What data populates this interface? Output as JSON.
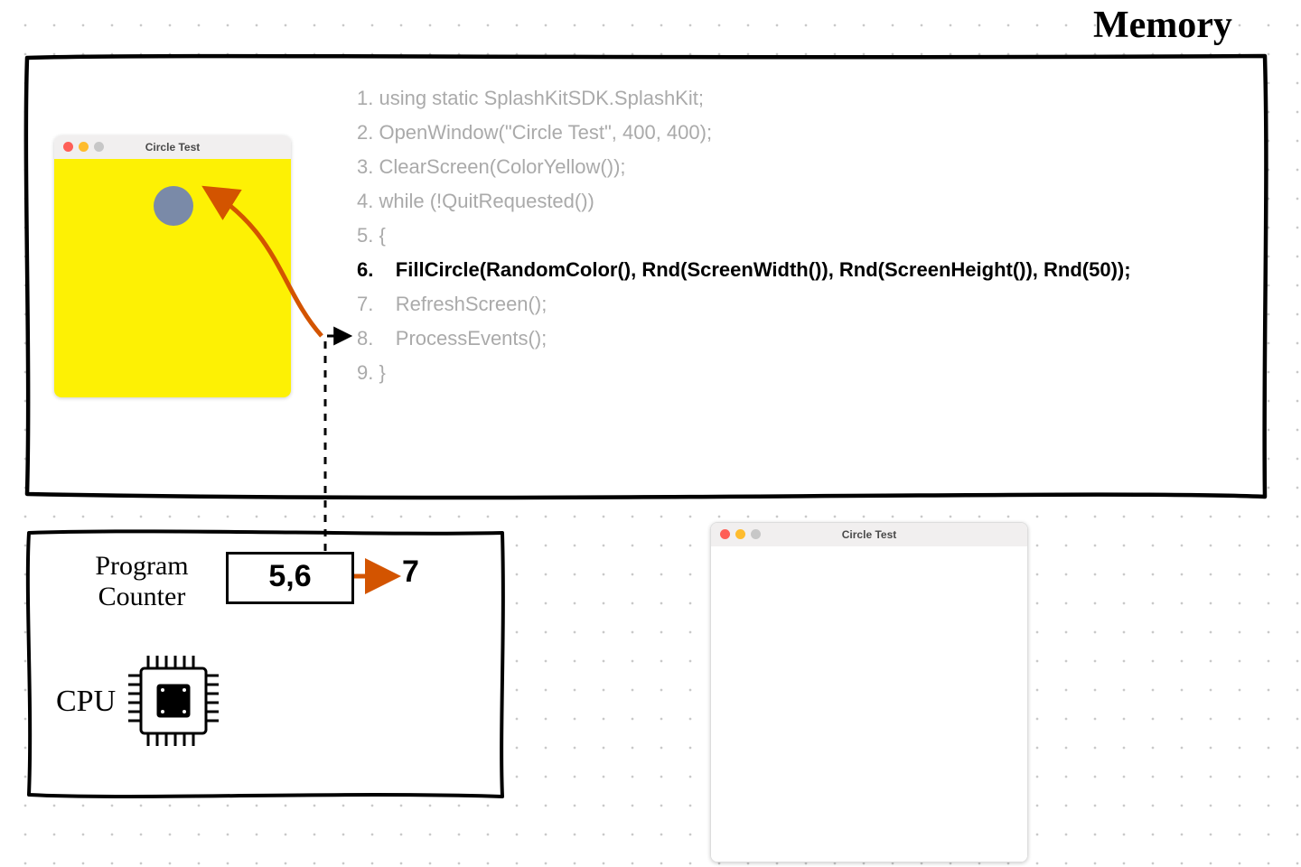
{
  "labels": {
    "memory": "Memory",
    "program_counter_line1": "Program",
    "program_counter_line2": "Counter",
    "cpu": "CPU"
  },
  "code": {
    "active_index": 5,
    "lines": [
      "1. using static SplashKitSDK.SplashKit;",
      "",
      "2. OpenWindow(\"Circle Test\", 400, 400);",
      "3. ClearScreen(ColorYellow());",
      "",
      "4. while (!QuitRequested())",
      "5. {",
      "6.    FillCircle(RandomColor(), Rnd(ScreenWidth()), Rnd(ScreenHeight()), Rnd(50));",
      "7.    RefreshScreen();",
      "8.    ProcessEvents();",
      "9. }"
    ]
  },
  "program_counter": {
    "value": "5,6",
    "next": "7"
  },
  "windows": {
    "yellow": {
      "title": "Circle Test"
    },
    "blank": {
      "title": "Circle Test"
    }
  },
  "colors": {
    "canvas_yellow": "#fdf104",
    "circle_fill": "#7a8aa8",
    "arrow_orange": "#d35400"
  }
}
